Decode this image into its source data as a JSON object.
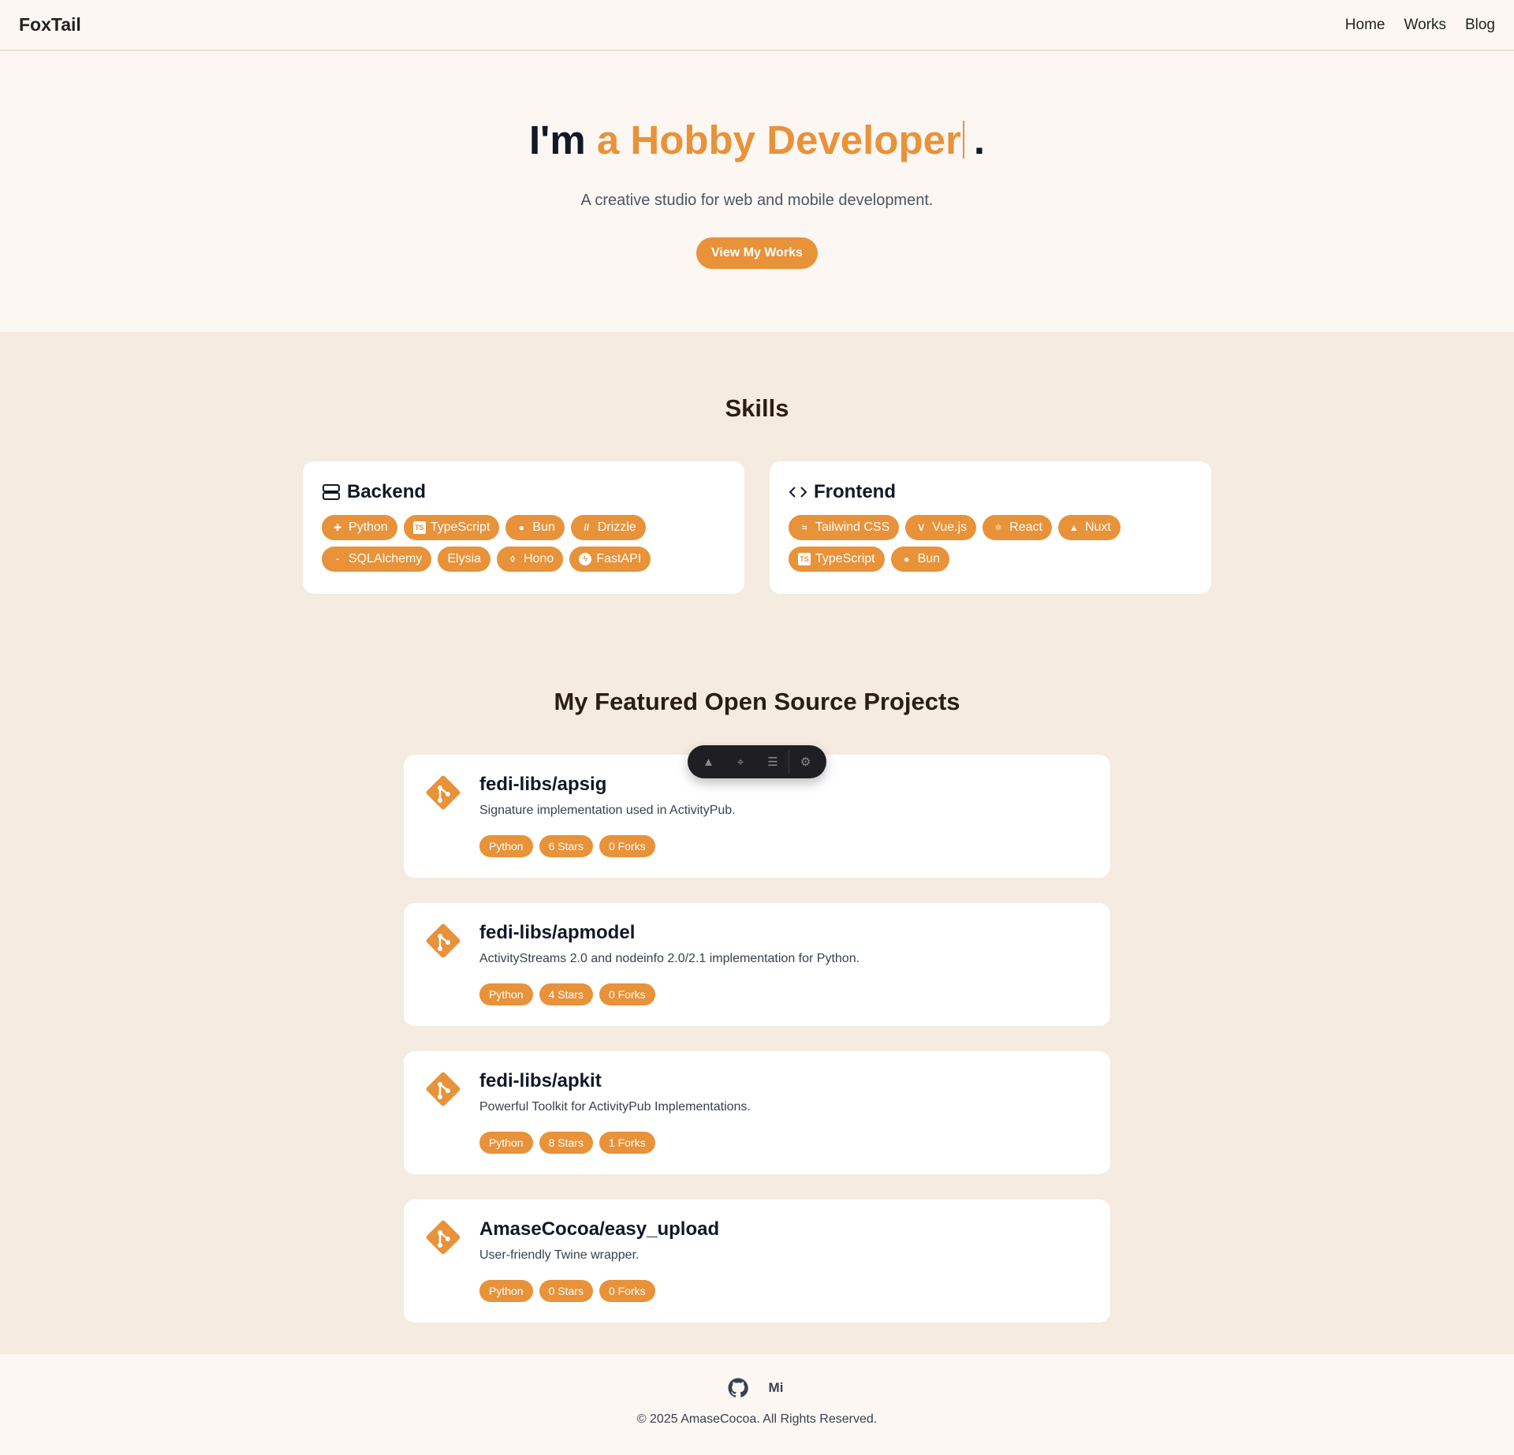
{
  "header": {
    "brand": "FoxTail",
    "nav": [
      "Home",
      "Works",
      "Blog"
    ]
  },
  "hero": {
    "prefix": "I'm",
    "highlight": "a Hobby Developer",
    "suffix": ".",
    "tagline": "A creative studio for web and mobile development.",
    "cta": "View My Works"
  },
  "skills": {
    "title": "Skills",
    "backend": {
      "title": "Backend",
      "items": [
        {
          "label": "Python",
          "icon": "python-icon"
        },
        {
          "label": "TypeScript",
          "icon": "typescript-icon"
        },
        {
          "label": "Bun",
          "icon": "bun-icon"
        },
        {
          "label": "Drizzle",
          "icon": "drizzle-icon"
        },
        {
          "label": "SQLAlchemy",
          "icon": "sqlalchemy-icon"
        },
        {
          "label": "Elysia",
          "icon": ""
        },
        {
          "label": "Hono",
          "icon": "hono-icon"
        },
        {
          "label": "FastAPI",
          "icon": "fastapi-icon"
        }
      ]
    },
    "frontend": {
      "title": "Frontend",
      "items": [
        {
          "label": "Tailwind CSS",
          "icon": "tailwind-icon"
        },
        {
          "label": "Vue.js",
          "icon": "vue-icon"
        },
        {
          "label": "React",
          "icon": "react-icon"
        },
        {
          "label": "Nuxt",
          "icon": "nuxt-icon"
        },
        {
          "label": "TypeScript",
          "icon": "typescript-icon"
        },
        {
          "label": "Bun",
          "icon": "bun-icon"
        }
      ]
    }
  },
  "projects": {
    "title": "My Featured Open Source Projects",
    "items": [
      {
        "name": "fedi-libs/apsig",
        "desc": "Signature implementation used in ActivityPub.",
        "lang": "Python",
        "stars": "6 Stars",
        "forks": "0 Forks"
      },
      {
        "name": "fedi-libs/apmodel",
        "desc": "ActivityStreams 2.0 and nodeinfo 2.0/2.1 implementation for Python.",
        "lang": "Python",
        "stars": "4 Stars",
        "forks": "0 Forks"
      },
      {
        "name": "fedi-libs/apkit",
        "desc": "Powerful Toolkit for ActivityPub Implementations.",
        "lang": "Python",
        "stars": "8 Stars",
        "forks": "1 Forks"
      },
      {
        "name": "AmaseCocoa/easy_upload",
        "desc": "User-friendly Twine wrapper.",
        "lang": "Python",
        "stars": "0 Stars",
        "forks": "0 Forks"
      }
    ]
  },
  "footer": {
    "social": [
      "github-icon",
      "misskey-icon"
    ],
    "misskey_glyph": "Mi",
    "copyright": "© 2025 AmaseCocoa. All Rights Reserved."
  },
  "colors": {
    "accent": "#e8923a",
    "page_bg": "#f5ebe0",
    "header_bg": "#fcf7f2"
  }
}
